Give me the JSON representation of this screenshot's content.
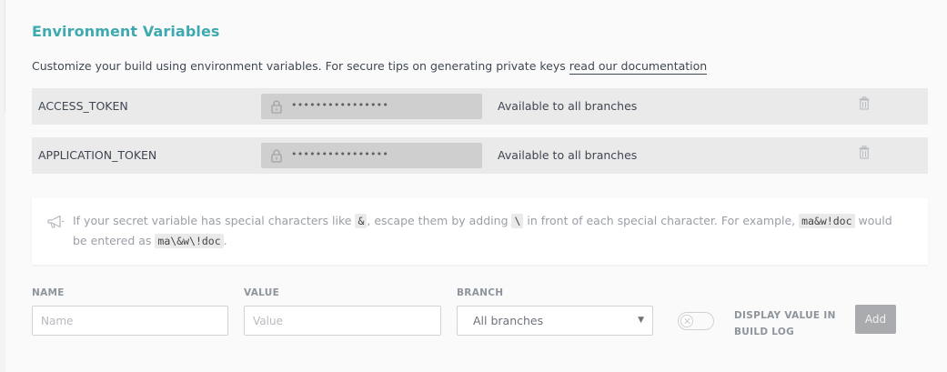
{
  "section": {
    "title": "Environment Variables",
    "description_prefix": "Customize your build using environment variables. For secure tips on generating private keys ",
    "description_link": "read our documentation"
  },
  "variables": [
    {
      "name": "ACCESS_TOKEN",
      "value_masked": "••••••••••••••••",
      "branch": "Available to all branches"
    },
    {
      "name": "APPLICATION_TOKEN",
      "value_masked": "••••••••••••••••",
      "branch": "Available to all branches"
    }
  ],
  "notice": {
    "t1": "If your secret variable has special characters like ",
    "c1": "&",
    "t2": ", escape them by adding ",
    "c2": "\\",
    "t3": " in front of each special character. For example, ",
    "c3": "ma&w!doc",
    "t4": " would be entered as ",
    "c4": "ma\\&w\\!doc",
    "t5": "."
  },
  "form": {
    "name_label": "NAME",
    "name_placeholder": "Name",
    "value_label": "VALUE",
    "value_placeholder": "Value",
    "branch_label": "BRANCH",
    "branch_selected": "All branches",
    "display_label": "DISPLAY VALUE IN BUILD LOG",
    "display_toggle_on": false,
    "add_label": "Add"
  },
  "colors": {
    "accent": "#3eaaaf",
    "row_background": "#eaeaea",
    "masked_value_background": "#cfcfcf",
    "add_button": "#a9abae"
  },
  "icons": [
    "lock-icon",
    "trash-icon",
    "megaphone-icon",
    "close-icon"
  ]
}
